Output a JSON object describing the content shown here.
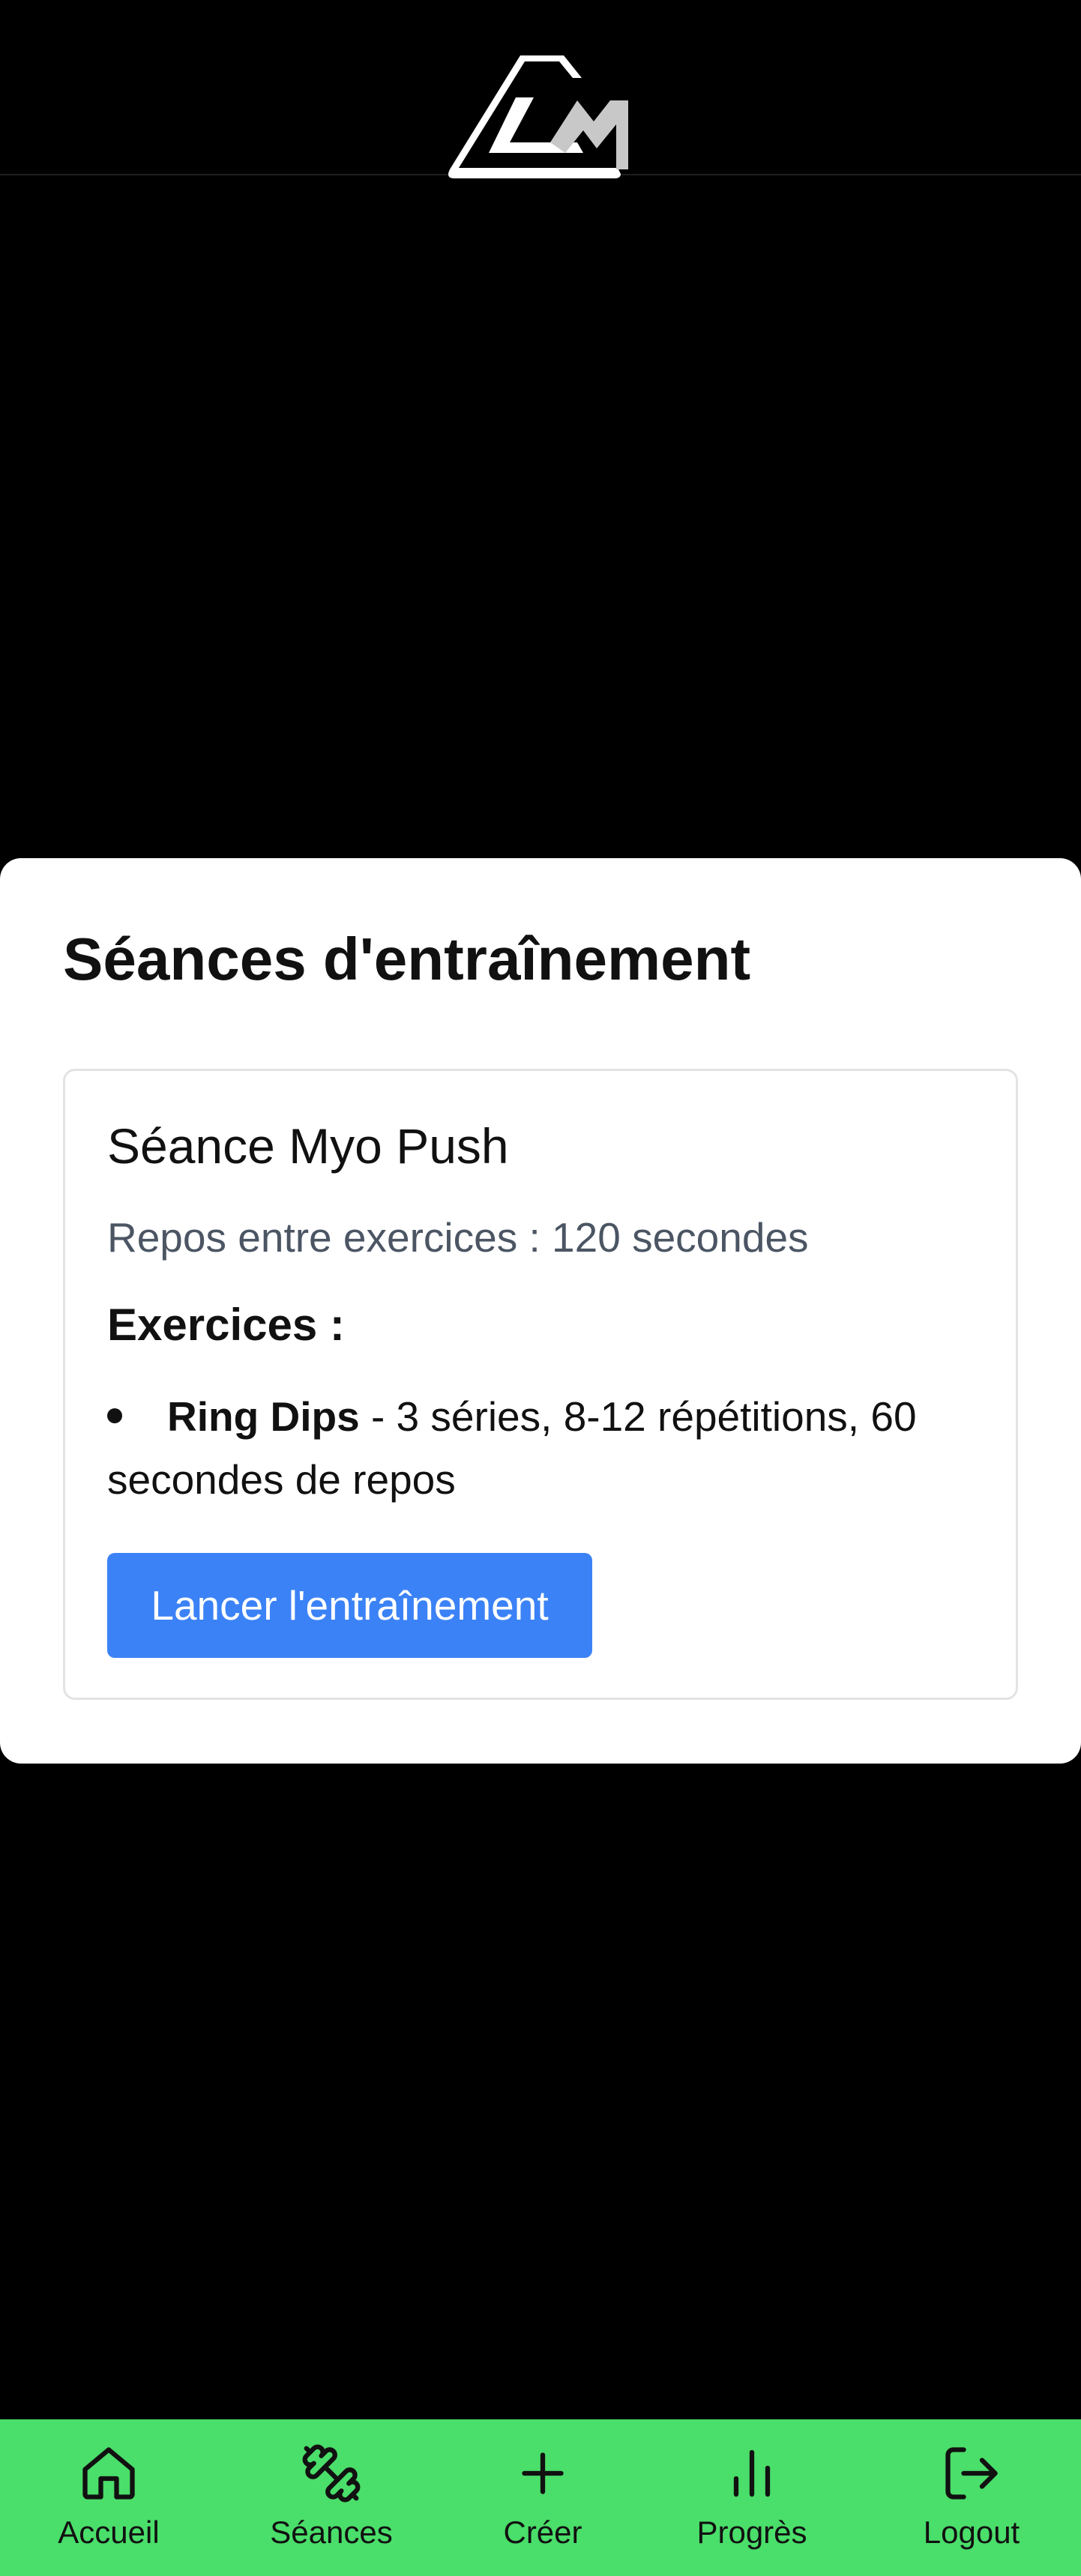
{
  "header": {
    "logo_icon": "brand-logo-icon"
  },
  "modal": {
    "title": "Séances d'entraînement",
    "session": {
      "name": "Séance Myo Push",
      "rest_text": "Repos entre exercices : 120 secondes",
      "exercises_heading": "Exercices :",
      "exercises": [
        {
          "name": "Ring Dips",
          "details": " - 3 séries, 8-12 répétitions, 60 secondes de repos"
        }
      ],
      "launch_label": "Lancer l'entraînement"
    }
  },
  "nav": {
    "items": [
      {
        "label": "Accueil",
        "icon": "home-icon"
      },
      {
        "label": "Séances",
        "icon": "dumbbell-icon"
      },
      {
        "label": "Créer",
        "icon": "plus-icon"
      },
      {
        "label": "Progrès",
        "icon": "bar-chart-icon"
      },
      {
        "label": "Logout",
        "icon": "logout-icon"
      }
    ]
  },
  "colors": {
    "accent": "#3b82f6",
    "nav_background": "#4ade6a",
    "page_background": "#000000"
  }
}
